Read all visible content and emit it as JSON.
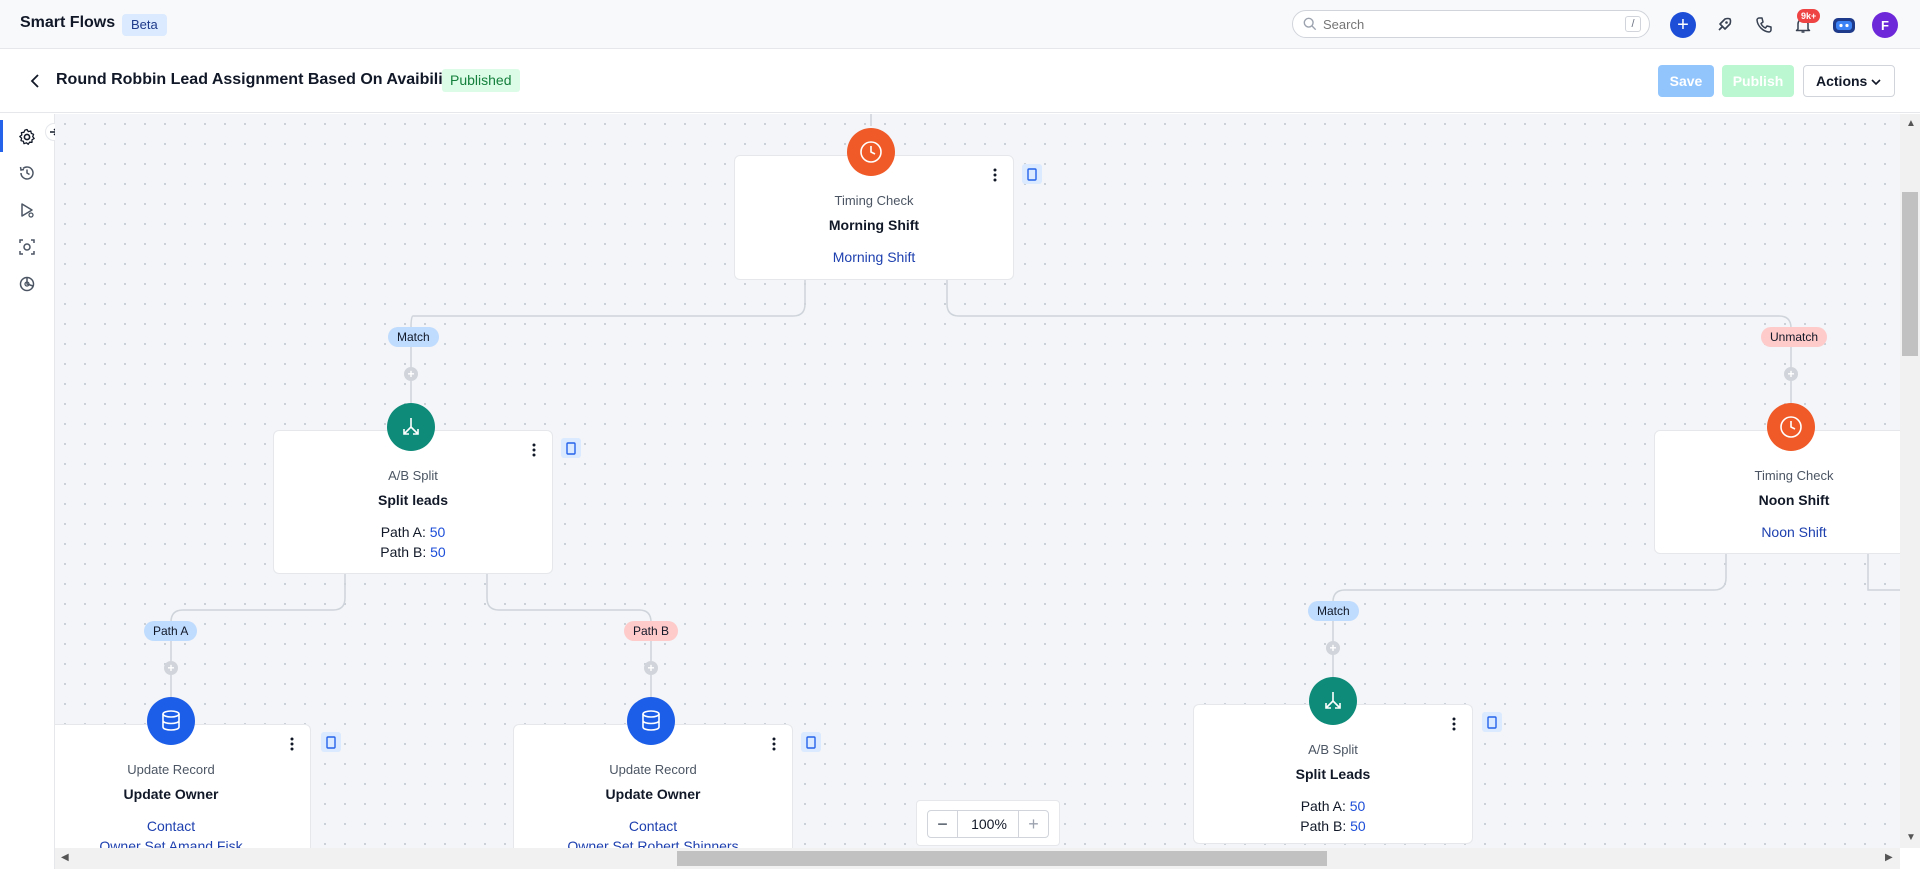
{
  "app": {
    "title": "Smart Flows",
    "beta": "Beta"
  },
  "search": {
    "placeholder": "Search",
    "shortcut": "/"
  },
  "topbar": {
    "notification_count": "9k+",
    "avatar_initial": "F"
  },
  "header": {
    "title": "Round Robbin Lead Assignment Based On Avaibility",
    "status": "Published",
    "save_label": "Save",
    "publish_label": "Publish",
    "actions_label": "Actions"
  },
  "rail": {
    "items": [
      "gear-icon",
      "history-icon",
      "test-run-icon",
      "scan-icon",
      "analytics-icon"
    ]
  },
  "nodes": {
    "morning": {
      "type": "Timing Check",
      "name": "Morning Shift",
      "link": "Morning Shift"
    },
    "split1": {
      "type": "A/B Split",
      "name": "Split leads",
      "path_a_label": "Path A:",
      "path_a": "50",
      "path_b_label": "Path B:",
      "path_b": "50"
    },
    "noon": {
      "type": "Timing Check",
      "name": "Noon Shift",
      "link": "Noon Shift"
    },
    "update1": {
      "type": "Update Record",
      "name": "Update Owner",
      "link1": "Contact",
      "link2": "Owner Set Amand Fisk"
    },
    "update2": {
      "type": "Update Record",
      "name": "Update Owner",
      "link1": "Contact",
      "link2": "Owner Set Robert Shinners"
    },
    "split2": {
      "type": "A/B Split",
      "name": "Split Leads",
      "path_a_label": "Path A:",
      "path_a": "50",
      "path_b_label": "Path B:",
      "path_b": "50"
    }
  },
  "labels": {
    "match1": "Match",
    "unmatch1": "Unmatch",
    "path_a": "Path A",
    "path_b": "Path B",
    "match2": "Match"
  },
  "zoom": {
    "value": "100%"
  },
  "colors": {
    "accent": "#1d4ed8",
    "timing": "#f05a28",
    "split": "#0f8b7a",
    "update": "#1d5ee8",
    "published": "#15803d"
  }
}
